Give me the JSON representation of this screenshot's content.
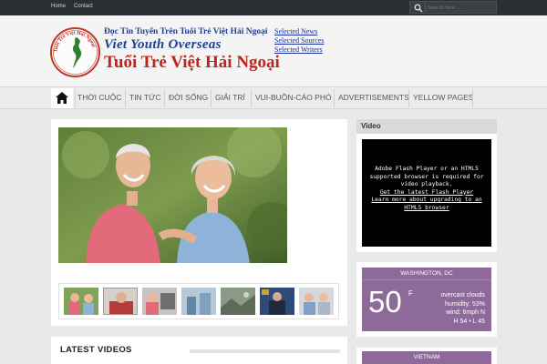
{
  "topbar": {
    "links": [
      "Home",
      "Contact"
    ],
    "search_placeholder": "Search here ..."
  },
  "logo": {
    "line1": "Đọc Tin Tuyển Trên Tuổi Trẻ Việt Hải Ngoại",
    "line2": "Viet Youth Overseas",
    "line3": "Tuổi Trẻ Việt Hải Ngoại",
    "seal_text": "Tuổi Trẻ Việt Hải Ngoại",
    "links": [
      "Selected News",
      "Selected Sources",
      "Selected Writers"
    ]
  },
  "nav": {
    "home_icon": "home-icon",
    "items": [
      "THỜI CUỘC",
      "TIN TỨC",
      "ĐỜI SỐNG",
      "GIẢI TRÍ",
      "VUI-BUỒN-CÁO PHÓ",
      "ADVERTISEMENTS",
      "YELLOW PAGES"
    ]
  },
  "main": {
    "latest_videos": "LATEST VIDEOS"
  },
  "sidebar": {
    "video_title": "Video",
    "video_message": "Adobe Flash Player or an HTML5 supported browser is required for video playback.",
    "video_link1": "Get the latest Flash Player",
    "video_link2": "Learn more about upgrading to an HTML5 browser",
    "weather": {
      "city": "WASHINGTON, DC",
      "temp": "50",
      "unit": "F",
      "condition": "overcast clouds",
      "humidity": "humidity: 53%",
      "wind": "wind: 6mph N",
      "hilo": "H 54 • L 45"
    },
    "weather2_city": "VIETNAM"
  },
  "colors": {
    "topbar": "#2b2e33",
    "weather": "#8e6a9a",
    "logo_blue": "#1f3f8f",
    "logo_red": "#c0241b"
  }
}
